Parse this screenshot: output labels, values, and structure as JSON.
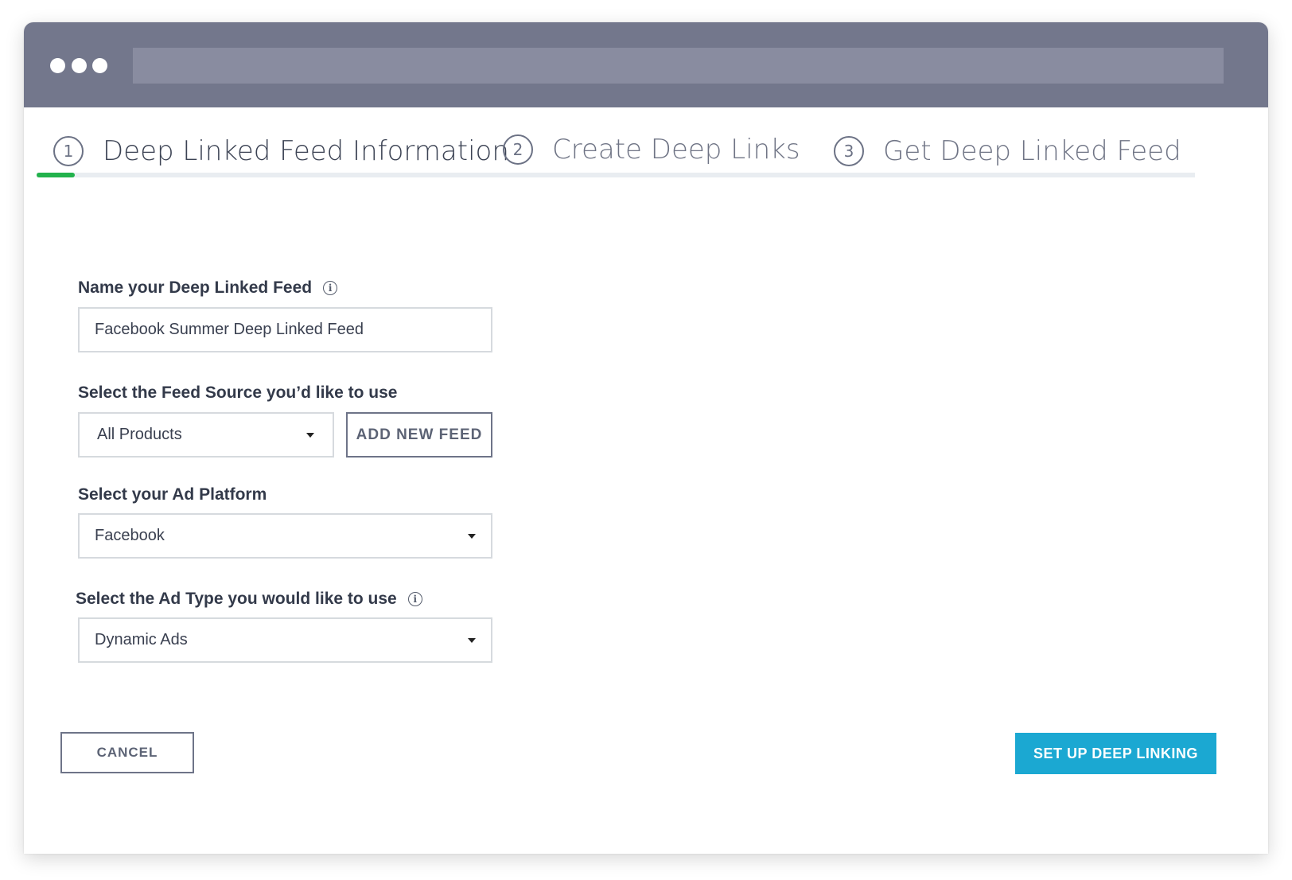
{
  "window": {
    "controls": [
      "window-dot",
      "window-dot",
      "window-dot"
    ]
  },
  "steps": [
    {
      "number": "1",
      "label": "Deep Linked Feed Information",
      "active": true
    },
    {
      "number": "2",
      "label": "Create Deep Links",
      "active": false
    },
    {
      "number": "3",
      "label": "Get Deep Linked Feed",
      "active": false
    }
  ],
  "progress": {
    "fraction": 0.033,
    "color": "#22b24c"
  },
  "form": {
    "feed_name": {
      "label": "Name your Deep Linked Feed",
      "info_icon": "info-icon",
      "value": "Facebook Summer Deep Linked Feed"
    },
    "feed_source": {
      "label": "Select the Feed Source you’d like to use",
      "selected": "All Products",
      "add_button": "ADD NEW FEED"
    },
    "ad_platform": {
      "label": "Select your Ad Platform",
      "selected": "Facebook"
    },
    "ad_type": {
      "label": "Select the Ad Type you would like to use",
      "info_icon": "info-icon",
      "selected": "Dynamic Ads"
    }
  },
  "actions": {
    "cancel": "CANCEL",
    "submit": "SET UP DEEP LINKING"
  },
  "colors": {
    "titlebar": "#73778c",
    "primary": "#1ba8d2",
    "progress": "#22b24c"
  }
}
